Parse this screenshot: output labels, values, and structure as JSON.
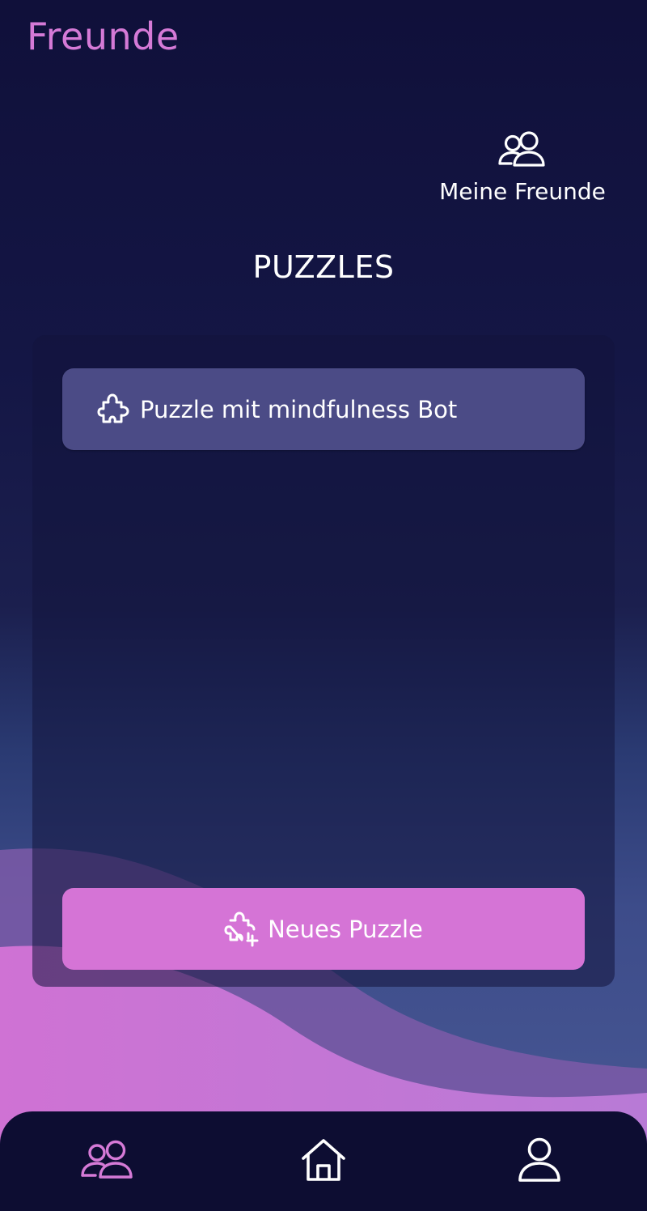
{
  "header": {
    "title": "Freunde"
  },
  "friends_link": {
    "label": "Meine Freunde",
    "icon": "users-icon"
  },
  "section": {
    "title": "PUZZLES"
  },
  "puzzles": [
    {
      "label": "Puzzle mit mindfulness Bot",
      "icon": "puzzle-icon"
    }
  ],
  "new_puzzle_button": {
    "label": "Neues Puzzle",
    "icon": "puzzle-plus-icon"
  },
  "bottom_nav": {
    "items": [
      {
        "name": "friends",
        "icon": "users-icon",
        "active": true
      },
      {
        "name": "home",
        "icon": "home-icon",
        "active": false
      },
      {
        "name": "profile",
        "icon": "user-icon",
        "active": false
      }
    ]
  },
  "colors": {
    "accent": "#d57ad7",
    "background_top": "#10103a",
    "background_bottom": "#4a5a96",
    "puzzle_item": "#4b4b86",
    "nav_background": "#0d0d32"
  }
}
